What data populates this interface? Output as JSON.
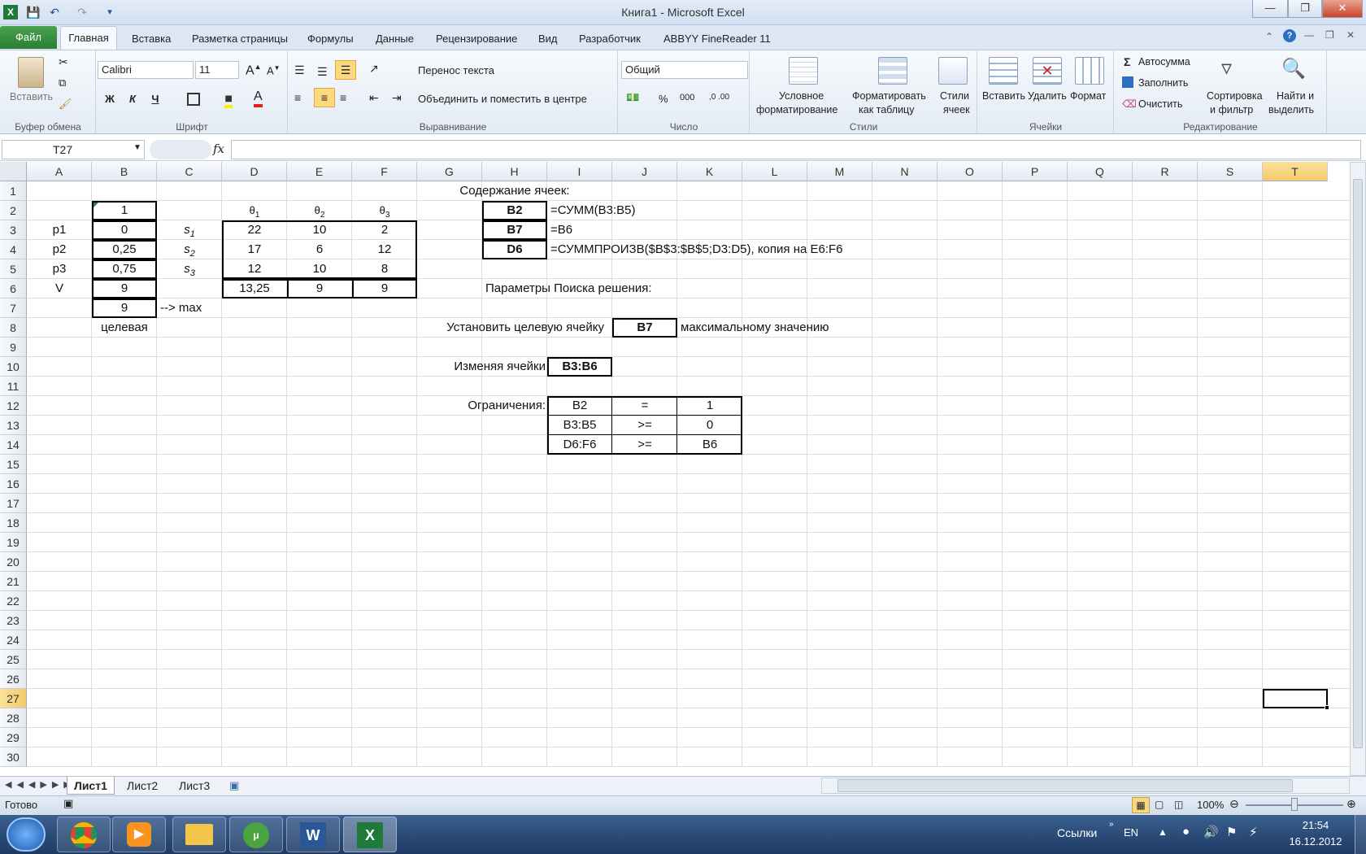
{
  "window": {
    "title": "Книга1 - Microsoft Excel"
  },
  "ribbon_tabs": [
    "Файл",
    "Главная",
    "Вставка",
    "Разметка страницы",
    "Формулы",
    "Данные",
    "Рецензирование",
    "Вид",
    "Разработчик",
    "ABBYY FineReader 11"
  ],
  "groups": {
    "clipboard": "Буфер обмена",
    "font": "Шрифт",
    "alignment": "Выравнивание",
    "number": "Число",
    "styles": "Стили",
    "cells": "Ячейки",
    "editing": "Редактирование"
  },
  "clipboard": {
    "paste": "Вставить"
  },
  "font": {
    "name": "Calibri",
    "size": "11",
    "bold": "Ж",
    "italic": "К",
    "underline": "Ч"
  },
  "alignment": {
    "wrap": "Перенос текста",
    "merge": "Объединить и поместить в центре"
  },
  "number": {
    "format": "Общий"
  },
  "styles": {
    "cond1": "Условное",
    "cond2": "форматирование",
    "table1": "Форматировать",
    "table2": "как таблицу",
    "cell1": "Стили",
    "cell2": "ячеек"
  },
  "cells": {
    "insert": "Вставить",
    "delete": "Удалить",
    "format": "Формат"
  },
  "editing": {
    "autosum": "Автосумма",
    "fill": "Заполнить",
    "clear": "Очистить",
    "sort1": "Сортировка",
    "sort2": "и фильтр",
    "find1": "Найти и",
    "find2": "выделить"
  },
  "formula_bar": {
    "name_box": "T27",
    "fx": "fx",
    "formula": ""
  },
  "columns": [
    "A",
    "B",
    "C",
    "D",
    "E",
    "F",
    "G",
    "H",
    "I",
    "J",
    "K",
    "L",
    "M",
    "N",
    "O",
    "P",
    "Q",
    "R",
    "S",
    "T"
  ],
  "rows": [
    "1",
    "2",
    "3",
    "4",
    "5",
    "6",
    "7",
    "8",
    "9",
    "10",
    "11",
    "12",
    "13",
    "14",
    "15",
    "16",
    "17",
    "18",
    "19",
    "20",
    "21",
    "22",
    "23",
    "24",
    "25",
    "26",
    "27",
    "28",
    "29",
    "30"
  ],
  "cells_data": {
    "b2": "1",
    "b3": "0",
    "b4": "0,25",
    "b5": "0,75",
    "b6": "9",
    "b7": "9",
    "b8": "целевая",
    "c7": "--> max",
    "a3": "p1",
    "a4": "p2",
    "a5": "p3",
    "a6": "V",
    "s1": "s",
    "s1sub": "1",
    "s2": "s",
    "s2sub": "2",
    "s3": "s",
    "s3sub": "3",
    "d2": "θ",
    "d2sub": "1",
    "e2": "θ",
    "e2sub": "2",
    "f2": "θ",
    "f2sub": "3",
    "d3": "22",
    "e3": "10",
    "f3": "2",
    "d4": "17",
    "e4": "6",
    "f4": "12",
    "d5": "12",
    "e5": "10",
    "f5": "8",
    "d6": "13,25",
    "e6": "9",
    "f6": "9",
    "g1": "Содержание ячеек:",
    "h2": "B2",
    "i2": "=СУММ(B3:B5)",
    "h3": "B7",
    "i3": "=B6",
    "h4": "D6",
    "i4": "=СУММПРОИЗВ($B$3:$B$5;D3:D5), копия на E6:F6",
    "h6": "Параметры Поиска решения:",
    "h8": "Установить целевую ячейку",
    "j8": "B7",
    "k8": "максимальному значению",
    "h10": "Изменяя ячейки",
    "i10": "B3:B6",
    "h12": "Ограничения:",
    "i12": "B2",
    "j12": "=",
    "k12": "1",
    "i13": "B3:B5",
    "j13": ">=",
    "k13": "0",
    "i14": "D6:F6",
    "j14": ">=",
    "k14": "B6"
  },
  "sheets": [
    "Лист1",
    "Лист2",
    "Лист3"
  ],
  "status": {
    "ready": "Готово",
    "zoom": "100%"
  },
  "taskbar": {
    "links": "Ссылки",
    "lang": "EN",
    "time": "21:54",
    "date": "16.12.2012"
  }
}
